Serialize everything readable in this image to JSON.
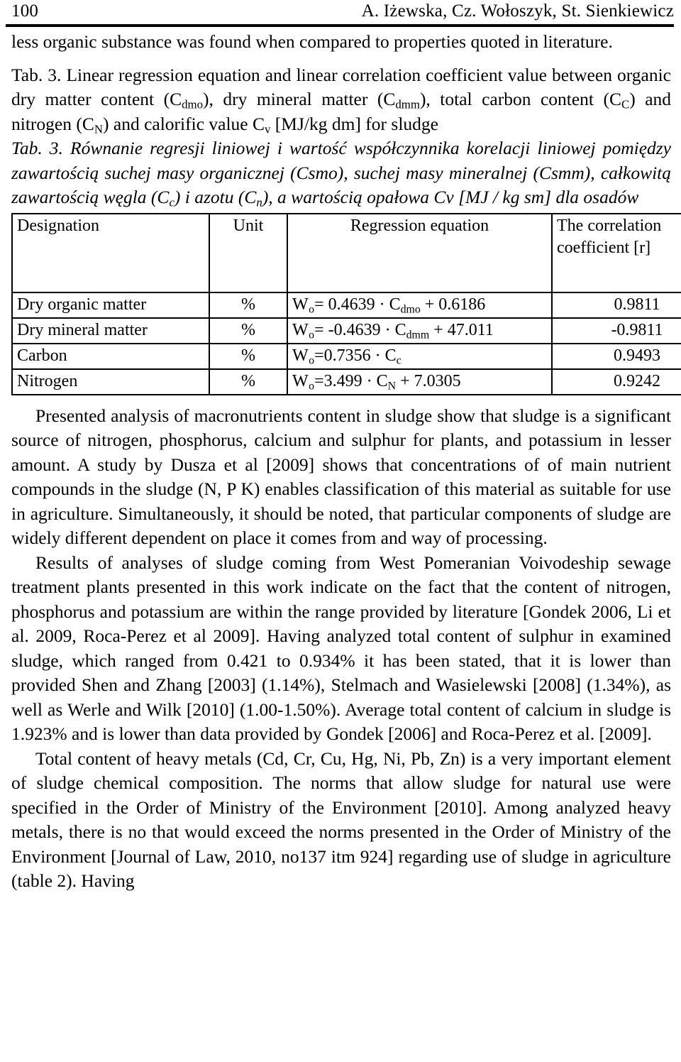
{
  "running_head": {
    "folio": "100",
    "authors": "A. Iżewska, Cz. Wołoszyk, St. Sienkiewicz"
  },
  "paragraphs": {
    "p_top": "less organic substance was found when compared to properties quoted in literature.",
    "p1": "Presented analysis of macronutrients content in sludge show that sludge is a significant source of nitrogen, phosphorus, calcium and sulphur for plants, and potassium in lesser amount. A study by Dusza et al [2009] shows that concentrations of of main nutrient compounds in the sludge (N, P K) enables classification of this material as suitable for use in agriculture. Simultaneously, it should be noted, that particular components of sludge are widely different dependent on place it comes from and way of processing.",
    "p2": "Results of analyses of sludge coming from West Pomeranian Voivodeship sewage treatment plants presented in this work indicate on the fact that the content of nitrogen, phosphorus and potassium are within the range provided by literature [Gondek 2006, Li et al. 2009, Roca-Perez et al 2009]. Having analyzed total content of sulphur in examined sludge, which ranged from 0.421 to 0.934% it has been stated, that it is lower than provided Shen and Zhang [2003] (1.14%), Stelmach and Wasielewski [2008] (1.34%), as well as Werle and Wilk [2010] (1.00-1.50%). Average total content of calcium in sludge is 1.923% and is lower than data provided by Gondek [2006] and Roca-Perez et al. [2009].",
    "p3": "Total content of heavy metals (Cd, Cr, Cu, Hg, Ni, Pb, Zn) is a very important element of sludge chemical composition. The norms that allow sludge for natural use were specified in the Order of Ministry of the Environment [2010]. Among analyzed heavy metals, there is no that would exceed the norms presented in the Order of Ministry of the Environment [Journal of Law, 2010, no137 itm 924] regarding use of sludge in agriculture (table 2). Having"
  },
  "caption_en": {
    "label": "Tab. 3.",
    "part1": " Linear regression equation and linear correlation coefficient value between organic dry matter content (C",
    "sub1": "dmo",
    "part2": "), dry mineral matter (C",
    "sub2": "dmm",
    "part3": "), total carbon content (C",
    "sub3": "C",
    "part4": ") and nitrogen (C",
    "sub4": "N",
    "part5": ") and calorific value C",
    "sub5": "v",
    "part6": " [MJ/kg dm] for sludge"
  },
  "caption_pl": {
    "label": "Tab. 3.",
    "part1": " Równanie regresji liniowej i wartość współczynnika korelacji liniowej pomiędzy zawartością suchej masy organicznej (Csmo), suchej masy mineralnej (Csmm), całkowitą zawartością węgla (C",
    "sub1": "c",
    "part2": ") i azotu (C",
    "sub2": "n",
    "part3": "), a wartością opałowa Cv [MJ / kg sm] dla osadów"
  },
  "table": {
    "headers": {
      "col1": "Designation",
      "col2": "Unit",
      "col3": "Regression equation",
      "col4_line1": "The correlation",
      "col4_line2": "coefficient [r]"
    },
    "rows": [
      {
        "designation": "Dry organic matter",
        "unit": "%",
        "eq_lhs": "W",
        "eq_lhs_sub": "o",
        "eq_mid": "= 0.4639 · C",
        "eq_sub": "dmo",
        "eq_tail": " + 0.6186",
        "correlation": "0.9811"
      },
      {
        "designation": "Dry mineral matter",
        "unit": "%",
        "eq_lhs": "W",
        "eq_lhs_sub": "o",
        "eq_mid": "= -0.4639 · C",
        "eq_sub": "dmm",
        "eq_tail": " + 47.011",
        "correlation": "-0.9811"
      },
      {
        "designation": "Carbon",
        "unit": "%",
        "eq_lhs": "W",
        "eq_lhs_sub": "o",
        "eq_mid": "=0.7356 · C",
        "eq_sub": "c",
        "eq_tail": "",
        "correlation": "0.9493"
      },
      {
        "designation": "Nitrogen",
        "unit": "%",
        "eq_lhs": "W",
        "eq_lhs_sub": "o",
        "eq_mid": "=3.499 · C",
        "eq_sub": "N",
        "eq_tail": " + 7.0305",
        "correlation": "0.9242"
      }
    ]
  }
}
